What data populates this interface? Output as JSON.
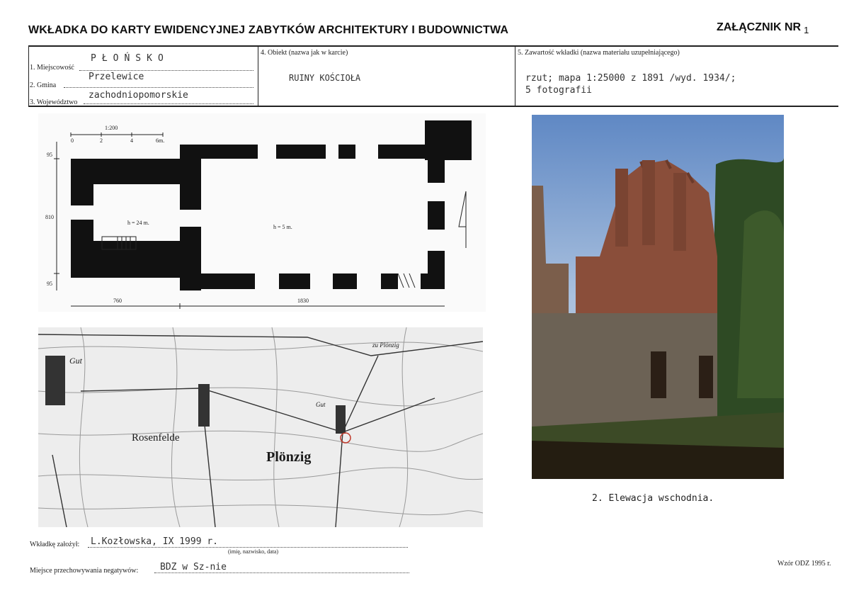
{
  "header": {
    "title": "WKŁADKA DO KARTY EWIDENCYJNEJ ZABYTKÓW ARCHITEKTURY I BUDOWNICTWA",
    "annex_label": "ZAŁĄCZNIK NR",
    "annex_number": "1"
  },
  "form": {
    "miejscowosc_label": "1. Miejscowość",
    "miejscowosc_value": "PŁOŃSKO",
    "gmina_label": "2. Gmina",
    "gmina_value": "Przelewice",
    "wojewodztwo_label": "3. Województwo",
    "wojewodztwo_value": "zachodniopomorskie",
    "obiekt_label": "4. Obiekt (nazwa jak w karcie)",
    "obiekt_value": "RUINY KOŚCIOŁA",
    "zawartosc_label": "5. Zawartość wkładki (nazwa materiału uzupełniającego)",
    "zawartosc_line1": "rzut; mapa 1:25000 z 1891 /wyd. 1934/;",
    "zawartosc_line2": "5 fotografii"
  },
  "plan": {
    "scale_label": "1:200",
    "scale_ticks": [
      "0",
      "2",
      "4",
      "6m."
    ],
    "dim_left_top": "95",
    "dim_left_mid": "810",
    "dim_left_bottom": "95",
    "dim_bottom_left": "760",
    "dim_bottom_right": "1830",
    "height_tower": "h = 24 m.",
    "height_nave": "h = 5 m."
  },
  "map": {
    "place_gut_left": "Gut",
    "place_rosenfelde": "Rosenfelde",
    "place_plonzig": "Plönzig",
    "place_gut_right": "Gut",
    "road_label": "zu Plönzig"
  },
  "photo": {
    "caption": "2. Elewacja wschodnia."
  },
  "footer": {
    "founder_label": "Wkładkę założył:",
    "founder_value": "L.Kozłowska, IX 1999 r.",
    "founder_hint": "(imię, nazwisko, data)",
    "storage_label": "Miejsce przechowywania negatywów:",
    "storage_value": "BDZ w Sz-nie",
    "template_label": "Wzór ODZ 1995 r."
  }
}
